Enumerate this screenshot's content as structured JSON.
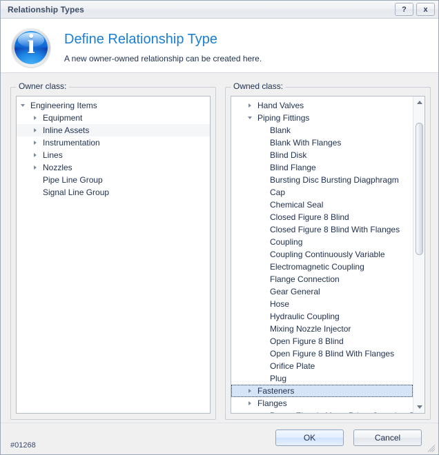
{
  "window": {
    "title": "Relationship Types",
    "help_button": "?",
    "close_button": "x"
  },
  "header": {
    "icon": "info-icon",
    "title": "Define Relationship Type",
    "subtitle": "A new owner-owned relationship can be created here."
  },
  "owner_panel": {
    "label": "Owner class:",
    "items": [
      {
        "label": "Engineering Items",
        "indent": 0,
        "arrow": "expanded",
        "state": "normal"
      },
      {
        "label": "Equipment",
        "indent": 1,
        "arrow": "collapsed",
        "state": "normal"
      },
      {
        "label": "Inline Assets",
        "indent": 1,
        "arrow": "collapsed",
        "state": "hover"
      },
      {
        "label": "Instrumentation",
        "indent": 1,
        "arrow": "collapsed",
        "state": "normal"
      },
      {
        "label": "Lines",
        "indent": 1,
        "arrow": "collapsed",
        "state": "normal"
      },
      {
        "label": "Nozzles",
        "indent": 1,
        "arrow": "collapsed",
        "state": "normal"
      },
      {
        "label": "Pipe Line Group",
        "indent": 1,
        "arrow": "none",
        "state": "normal"
      },
      {
        "label": "Signal Line Group",
        "indent": 1,
        "arrow": "none",
        "state": "normal"
      }
    ]
  },
  "owned_panel": {
    "label": "Owned class:",
    "items": [
      {
        "label": "Hand Valves",
        "indent": 1,
        "arrow": "collapsed",
        "state": "normal"
      },
      {
        "label": "Piping Fittings",
        "indent": 1,
        "arrow": "expanded",
        "state": "normal"
      },
      {
        "label": "Blank",
        "indent": 2,
        "arrow": "none",
        "state": "normal"
      },
      {
        "label": "Blank With Flanges",
        "indent": 2,
        "arrow": "none",
        "state": "normal"
      },
      {
        "label": "Blind Disk",
        "indent": 2,
        "arrow": "none",
        "state": "normal"
      },
      {
        "label": "Blind Flange",
        "indent": 2,
        "arrow": "none",
        "state": "normal"
      },
      {
        "label": "Bursting Disc Bursting Diagphragm",
        "indent": 2,
        "arrow": "none",
        "state": "normal"
      },
      {
        "label": "Cap",
        "indent": 2,
        "arrow": "none",
        "state": "normal"
      },
      {
        "label": "Chemical Seal",
        "indent": 2,
        "arrow": "none",
        "state": "normal"
      },
      {
        "label": "Closed Figure 8 Blind",
        "indent": 2,
        "arrow": "none",
        "state": "normal"
      },
      {
        "label": "Closed Figure 8 Blind With Flanges",
        "indent": 2,
        "arrow": "none",
        "state": "normal"
      },
      {
        "label": "Coupling",
        "indent": 2,
        "arrow": "none",
        "state": "normal"
      },
      {
        "label": "Coupling Continuously Variable",
        "indent": 2,
        "arrow": "none",
        "state": "normal"
      },
      {
        "label": "Electromagnetic Coupling",
        "indent": 2,
        "arrow": "none",
        "state": "normal"
      },
      {
        "label": "Flange Connection",
        "indent": 2,
        "arrow": "none",
        "state": "normal"
      },
      {
        "label": "Gear General",
        "indent": 2,
        "arrow": "none",
        "state": "normal"
      },
      {
        "label": "Hose",
        "indent": 2,
        "arrow": "none",
        "state": "normal"
      },
      {
        "label": "Hydraulic Coupling",
        "indent": 2,
        "arrow": "none",
        "state": "normal"
      },
      {
        "label": "Mixing Nozzle Injector",
        "indent": 2,
        "arrow": "none",
        "state": "normal"
      },
      {
        "label": "Open Figure 8 Blind",
        "indent": 2,
        "arrow": "none",
        "state": "normal"
      },
      {
        "label": "Open Figure 8 Blind With Flanges",
        "indent": 2,
        "arrow": "none",
        "state": "normal"
      },
      {
        "label": "Orifice Plate",
        "indent": 2,
        "arrow": "none",
        "state": "normal"
      },
      {
        "label": "Plug",
        "indent": 2,
        "arrow": "none",
        "state": "normal"
      },
      {
        "label": "Fasteners",
        "indent": 1,
        "arrow": "collapsed",
        "state": "selected"
      },
      {
        "label": "Flanges",
        "indent": 1,
        "arrow": "collapsed",
        "state": "normal"
      },
      {
        "label": "Power Electric Motor Prime Speed up Type",
        "indent": 2,
        "arrow": "none",
        "state": "clipped"
      }
    ],
    "scrollbar": {
      "up_arrow": "scroll-up",
      "down_arrow": "scroll-down",
      "thumb_top_pct": 5,
      "thumb_height_pct": 45
    }
  },
  "footer": {
    "status_id": "#01268",
    "ok_label": "OK",
    "cancel_label": "Cancel"
  }
}
